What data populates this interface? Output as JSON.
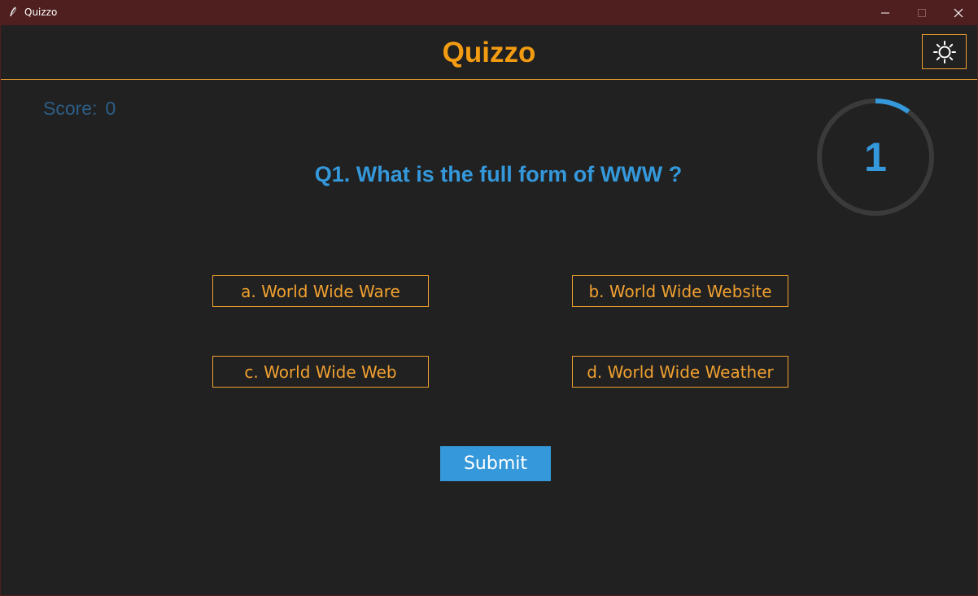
{
  "window": {
    "title": "Quizzo",
    "controls": [
      "minimize",
      "maximize",
      "close"
    ]
  },
  "header": {
    "app_title": "Quizzo",
    "theme_icon": "sun-icon"
  },
  "score": {
    "label": "Score:",
    "value": "0"
  },
  "timer": {
    "value": "1",
    "progress_fraction": 0.1
  },
  "question": {
    "text": "Q1. What is the full form of WWW ?"
  },
  "options": [
    {
      "label": "a. World Wide Ware"
    },
    {
      "label": "b. World Wide Website"
    },
    {
      "label": "c. World Wide Web"
    },
    {
      "label": "d. World Wide Weather"
    }
  ],
  "submit": {
    "label": "Submit"
  },
  "colors": {
    "background": "#212121",
    "titlebar": "#4f1f1f",
    "accent_orange": "#f39c12",
    "accent_blue": "#3498db",
    "score_text": "#2d5f88",
    "timer_track": "#3a3a3a"
  }
}
